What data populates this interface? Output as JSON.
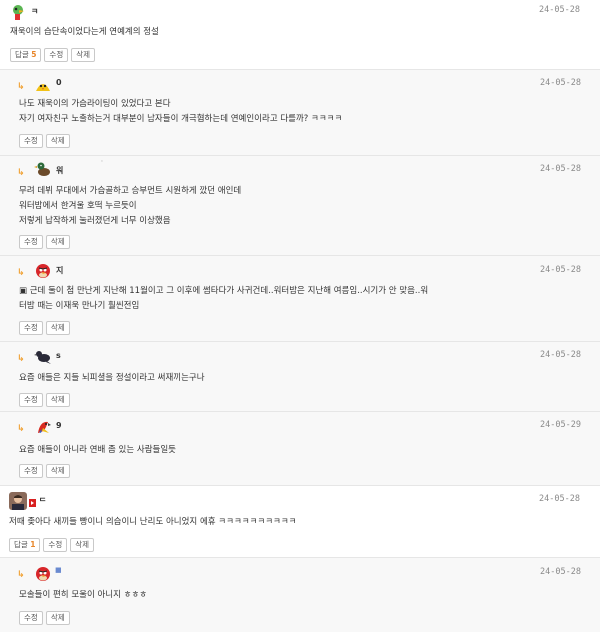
{
  "comments": [
    {
      "author": "ㅋ",
      "date": "24-05-28",
      "lines": [
        "재욱이의 습단속이었다는게 연예계의 정설"
      ],
      "reply_label": "답글",
      "reply_count": "5",
      "edit_label": "수정",
      "delete_label": "삭제"
    },
    {
      "author": "0",
      "date": "24-05-28",
      "lines": [
        "나도 재욱이의 가슴라이팅이 있었다고 본다",
        "자기 여자친구 노출하는거 대부분이 남자들이 개극혐하는데 연예인이라고 다를까? ㅋㅋㅋㅋ"
      ],
      "edit_label": "수정",
      "delete_label": "삭제"
    },
    {
      "author": "워",
      "date": "24-05-28",
      "lines": [
        "무려 데뷔 무대에서 가슴골하고 승부먼트 시원하게 깠던 애인데",
        "워터밤에서 한겨울 호떡 누르듯이",
        "저렇게 납작하게 눌러졌던게 너무 이상했음"
      ],
      "edit_label": "수정",
      "delete_label": "삭제"
    },
    {
      "author": "지",
      "date": "24-05-28",
      "lines": [
        "▣ 근데 둘이 첨 만난게 지난해 11월이고 그 이후에 썸타다가 사귀건데..워터밤은 지난해 여름임..시기가 안 맞음..워",
        "터밤 때는 이재욱 만나기 훨씬전임"
      ],
      "edit_label": "수정",
      "delete_label": "삭제"
    },
    {
      "author": "s",
      "date": "24-05-28",
      "lines": [
        "요즘 애들은 지들 뇌피셜을 정설이라고 써재끼는구나"
      ],
      "edit_label": "수정",
      "delete_label": "삭제"
    },
    {
      "author": "9",
      "date": "24-05-29",
      "lines": [
        "요즘 애들이 아니라 연배 좀 있는 사람들일듯"
      ],
      "edit_label": "수정",
      "delete_label": "삭제"
    },
    {
      "author": "ᄃ",
      "date": "24-05-28",
      "lines": [
        "저때 좆아다 새끼들 빵이니 의슴이니 난리도 아니었지 에휴 ㅋㅋㅋㅋㅋㅋㅋㅋㅋㅋ"
      ],
      "reply_label": "답글",
      "reply_count": "1",
      "edit_label": "수정",
      "delete_label": "삭제"
    },
    {
      "author": "■",
      "date": "24-05-28",
      "lines": [
        "모솔들이 편히 모울이 아니지 ㅎㅎㅎ"
      ],
      "edit_label": "수정",
      "delete_label": "삭제"
    }
  ],
  "colors": {
    "reply_bg": "#f8f8f8",
    "arrow": "#f0a030",
    "count": "#e8862a"
  },
  "icons": [
    "parrot-avatar",
    "chick-avatar",
    "duck-avatar",
    "angry-bird-avatar",
    "crow-avatar",
    "macaw-avatar",
    "user-photo-avatar",
    "angry-bird-avatar"
  ]
}
